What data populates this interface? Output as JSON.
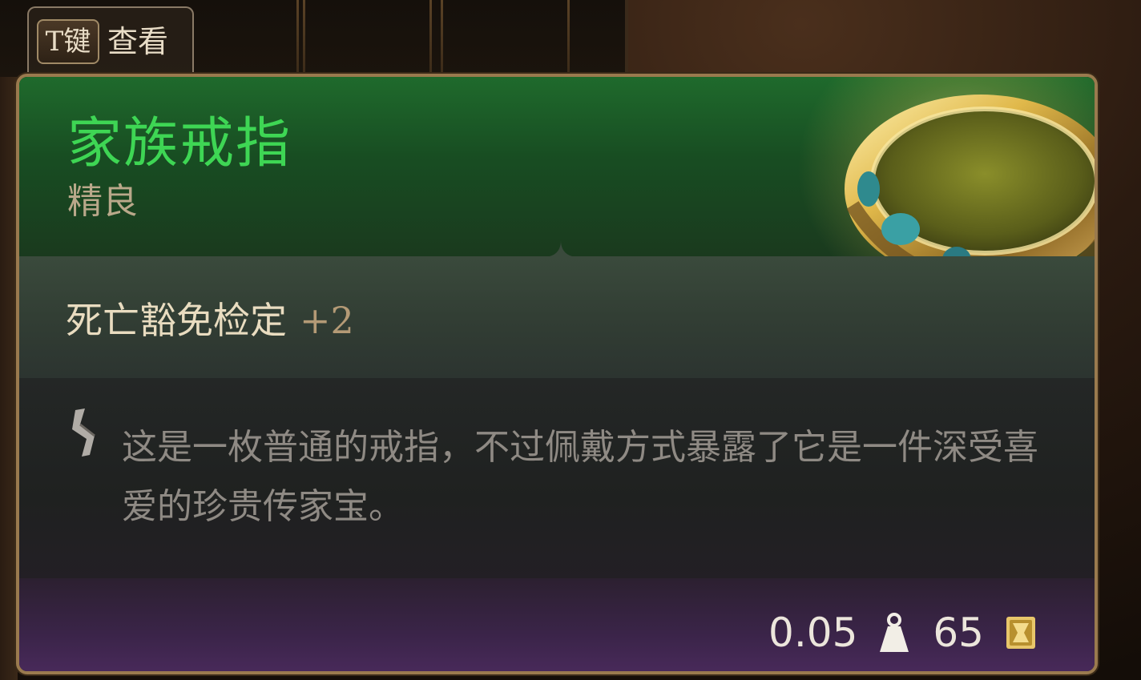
{
  "top_bar": {
    "key_label": "T键",
    "action_label": "查看"
  },
  "item": {
    "name": "家族戒指",
    "rarity": "精良",
    "rarity_color": "#3ed654",
    "image_icon": "gold-ring-icon"
  },
  "stats": [
    {
      "label": "死亡豁免检定",
      "bonus": "+2"
    }
  ],
  "description": {
    "icon": "scroll-icon",
    "text": "这是一枚普通的戒指，不过佩戴方式暴露了它是一件深受喜爱的珍贵传家宝。"
  },
  "footer": {
    "weight": "0.05",
    "weight_icon": "weight-icon",
    "value": "65",
    "value_icon": "gold-coin-icon"
  },
  "colors": {
    "header_green": "#1f6a2c",
    "footer_purple": "#4a2a5c",
    "border_gold": "#9a7a4e"
  }
}
